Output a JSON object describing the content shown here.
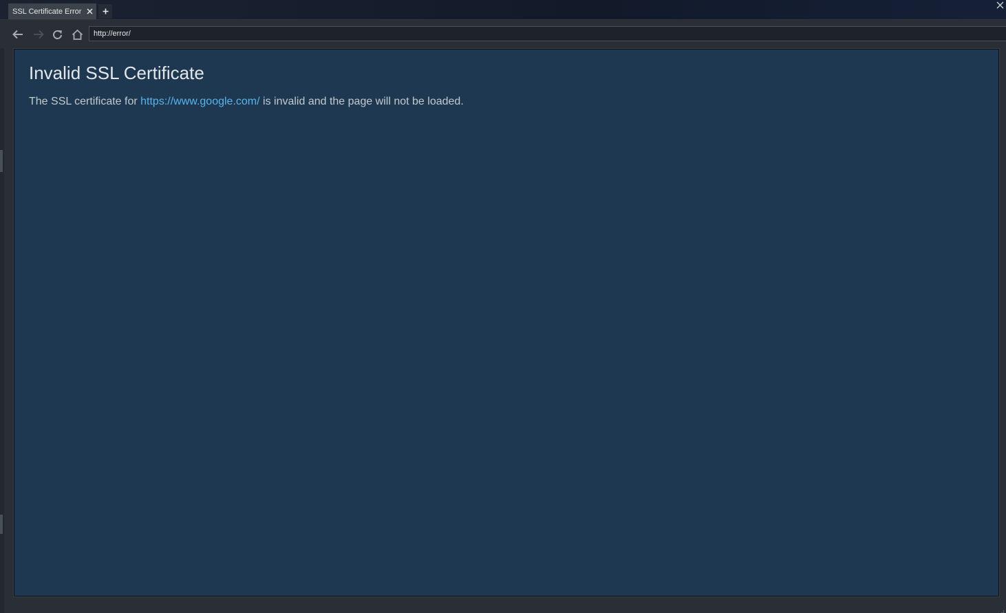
{
  "tab": {
    "title": "SSL Certificate Error",
    "close_icon": "close-icon"
  },
  "new_tab": {
    "icon": "plus-icon"
  },
  "window": {
    "close_icon": "close-icon"
  },
  "toolbar": {
    "back_icon": "arrow-left-icon",
    "forward_icon": "arrow-right-icon",
    "reload_icon": "reload-icon",
    "home_icon": "home-icon",
    "address": "http://error/"
  },
  "page": {
    "title": "Invalid SSL Certificate",
    "message_before": "The SSL certificate for ",
    "link": "https://www.google.com/",
    "message_after": " is invalid and the page will not be loaded.",
    "link_color": "#59b4ec",
    "background_color": "#1d3850"
  }
}
